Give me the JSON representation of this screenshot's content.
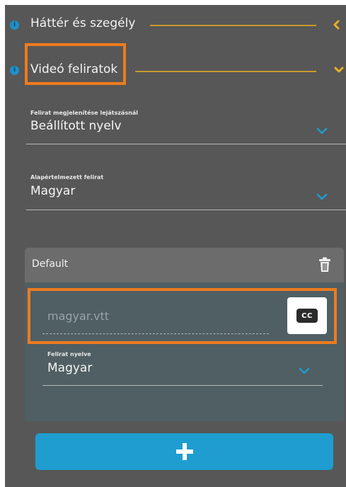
{
  "sections": [
    {
      "title": "Háttér és szegély",
      "info_icon": "info-icon",
      "chevron": "chevron-left-icon",
      "expanded": false
    },
    {
      "title": "Videó feliratok",
      "info_icon": "info-icon",
      "chevron": "chevron-down-icon",
      "expanded": true
    }
  ],
  "fields": {
    "display_on_play": {
      "label": "Felirat megjelenítése lejátszásnál",
      "value": "Beállított nyelv"
    },
    "default_subtitle": {
      "label": "Alapértelmezett felirat",
      "value": "Magyar"
    }
  },
  "subtitle_card": {
    "title": "Default",
    "file_name": "magyar.vtt",
    "cc_label": "CC",
    "language_field": {
      "label": "Felirat nyelve",
      "value": "Magyar"
    }
  },
  "colors": {
    "panel_bg": "#575757",
    "accent_line": "#c79a2e",
    "highlight": "#ef7b1d",
    "info_blue": "#1f8fc7",
    "select_chevron": "#1f9dd0",
    "add_button": "#1f9dd0"
  }
}
